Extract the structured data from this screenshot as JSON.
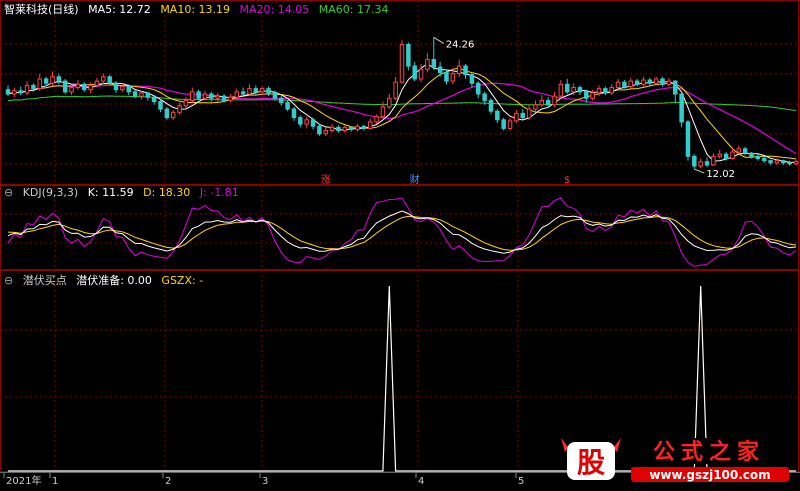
{
  "main_panel": {
    "stock_name": "智莱科技(日线)",
    "ma_labels": [
      {
        "text": "MA5: 12.72",
        "color": "#ffffff"
      },
      {
        "text": "MA10: 13.19",
        "color": "#ffd700"
      },
      {
        "text": "MA20: 14.05",
        "color": "#e000e0"
      },
      {
        "text": "MA60: 17.34",
        "color": "#33cc33"
      }
    ],
    "high_label": "24.26",
    "low_label": "12.02",
    "markers": [
      {
        "text": "涨",
        "color": "#ff3333"
      },
      {
        "text": "财",
        "color": "#3399ff"
      },
      {
        "text": "$",
        "color": "#ff3333"
      }
    ]
  },
  "kdj_panel": {
    "title": "KDJ(9,3,3)",
    "k_label": "K: 11.59",
    "d_label": "D: 18.30",
    "j_label": "J: -1.81"
  },
  "signal_panel": {
    "title": "潜伏买点",
    "series_label": "潜伏准备: 0.00",
    "gszx_label": "GSZX: -"
  },
  "x_axis": {
    "labels": [
      "2021年",
      "1",
      "2",
      "3",
      "4",
      "5"
    ]
  },
  "watermark": {
    "logo_char": "股",
    "title": "公式之家",
    "url": "www.gszj100.com"
  },
  "colors": {
    "up": "#ff4444",
    "down": "#33cccc",
    "grid": "#8b0000",
    "ma5": "#ffffff",
    "ma10": "#ffd700",
    "ma20": "#e000e0",
    "ma60": "#33cc33",
    "k": "#ffffff",
    "d": "#ffd700",
    "j": "#e000e0"
  },
  "chart_data": [
    {
      "type": "candlestick",
      "title": "智莱科技(日线)",
      "xlabel": "",
      "ylabel": "",
      "ylim": [
        11,
        27
      ],
      "high_annotation": 24.26,
      "low_annotation": 12.02,
      "series": [
        {
          "name": "MA5",
          "last": 12.72
        },
        {
          "name": "MA10",
          "last": 13.19
        },
        {
          "name": "MA20",
          "last": 14.05
        },
        {
          "name": "MA60",
          "last": 17.34
        }
      ]
    },
    {
      "type": "line",
      "title": "KDJ(9,3,3)",
      "ylim": [
        -20,
        110
      ],
      "series": [
        {
          "name": "K",
          "last": 11.59
        },
        {
          "name": "D",
          "last": 18.3
        },
        {
          "name": "J",
          "last": -1.81
        }
      ]
    },
    {
      "type": "line",
      "title": "潜伏买点",
      "ylim": [
        0,
        1
      ],
      "series": [
        {
          "name": "潜伏准备",
          "last": 0.0,
          "spikes": [
            {
              "x_label": "4",
              "value": 1
            },
            {
              "x_label": "5",
              "value": 1
            }
          ]
        }
      ]
    }
  ]
}
